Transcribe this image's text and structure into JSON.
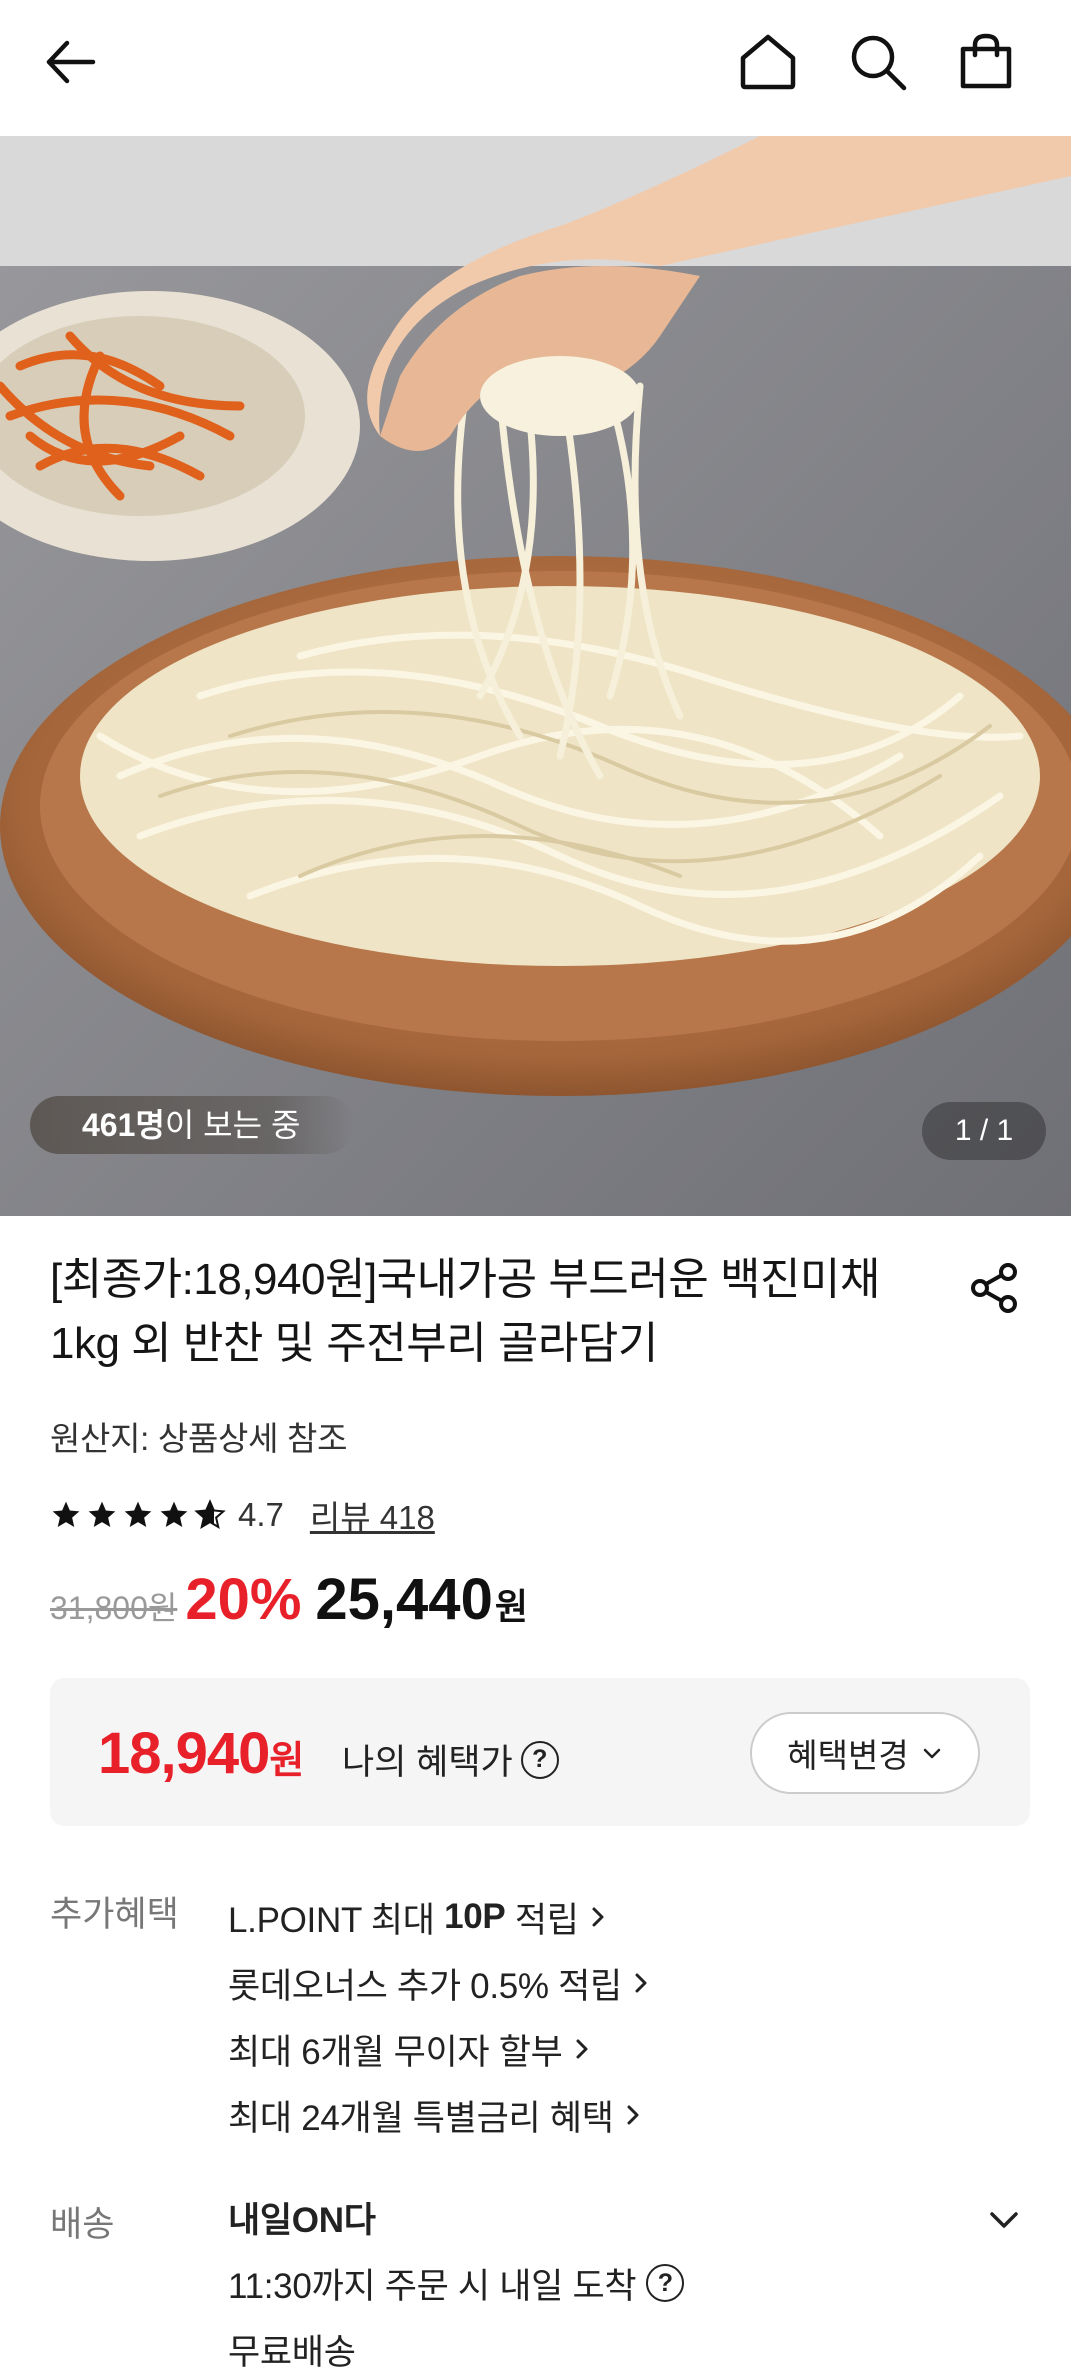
{
  "header": {
    "icons": [
      "back-arrow-icon",
      "home-icon",
      "search-icon",
      "cart-bag-icon"
    ]
  },
  "gallery": {
    "viewers_count": "461명",
    "viewers_suffix": "이 보는 중",
    "page_indicator": "1 / 1"
  },
  "product": {
    "title": "[최종가:18,940원]국내가공 부드러운 백진미채 1kg 외 반찬 및 주전부리 골라담기",
    "origin": "원산지: 상품상세 참조",
    "rating": "4.7",
    "rating_stars": 4.7,
    "review_label": "리뷰 418"
  },
  "price": {
    "original": "31,800원",
    "discount": "20%",
    "sale": "25,440",
    "unit": "원"
  },
  "benefit_price": {
    "amount": "18,940",
    "unit": "원",
    "label": "나의 혜택가",
    "change_button": "혜택변경"
  },
  "extra_benefits": {
    "label": "추가혜택",
    "items": [
      {
        "pre": "L.POINT 최대 ",
        "bold": "10P",
        "post": " 적립"
      },
      {
        "pre": "롯데오너스 추가 0.5% 적립",
        "bold": "",
        "post": ""
      },
      {
        "pre": "최대 6개월 무이자 할부",
        "bold": "",
        "post": ""
      },
      {
        "pre": "최대 24개월 특별금리 혜택",
        "bold": "",
        "post": ""
      }
    ]
  },
  "delivery": {
    "label": "배송",
    "name": "내일ON다",
    "eta": "11:30까지 주문 시 내일 도착",
    "fee": "무료배송"
  },
  "colors": {
    "accent_red": "#e8202a",
    "text_dark": "#111111",
    "muted": "#777777",
    "box_bg": "#f5f5f6"
  }
}
